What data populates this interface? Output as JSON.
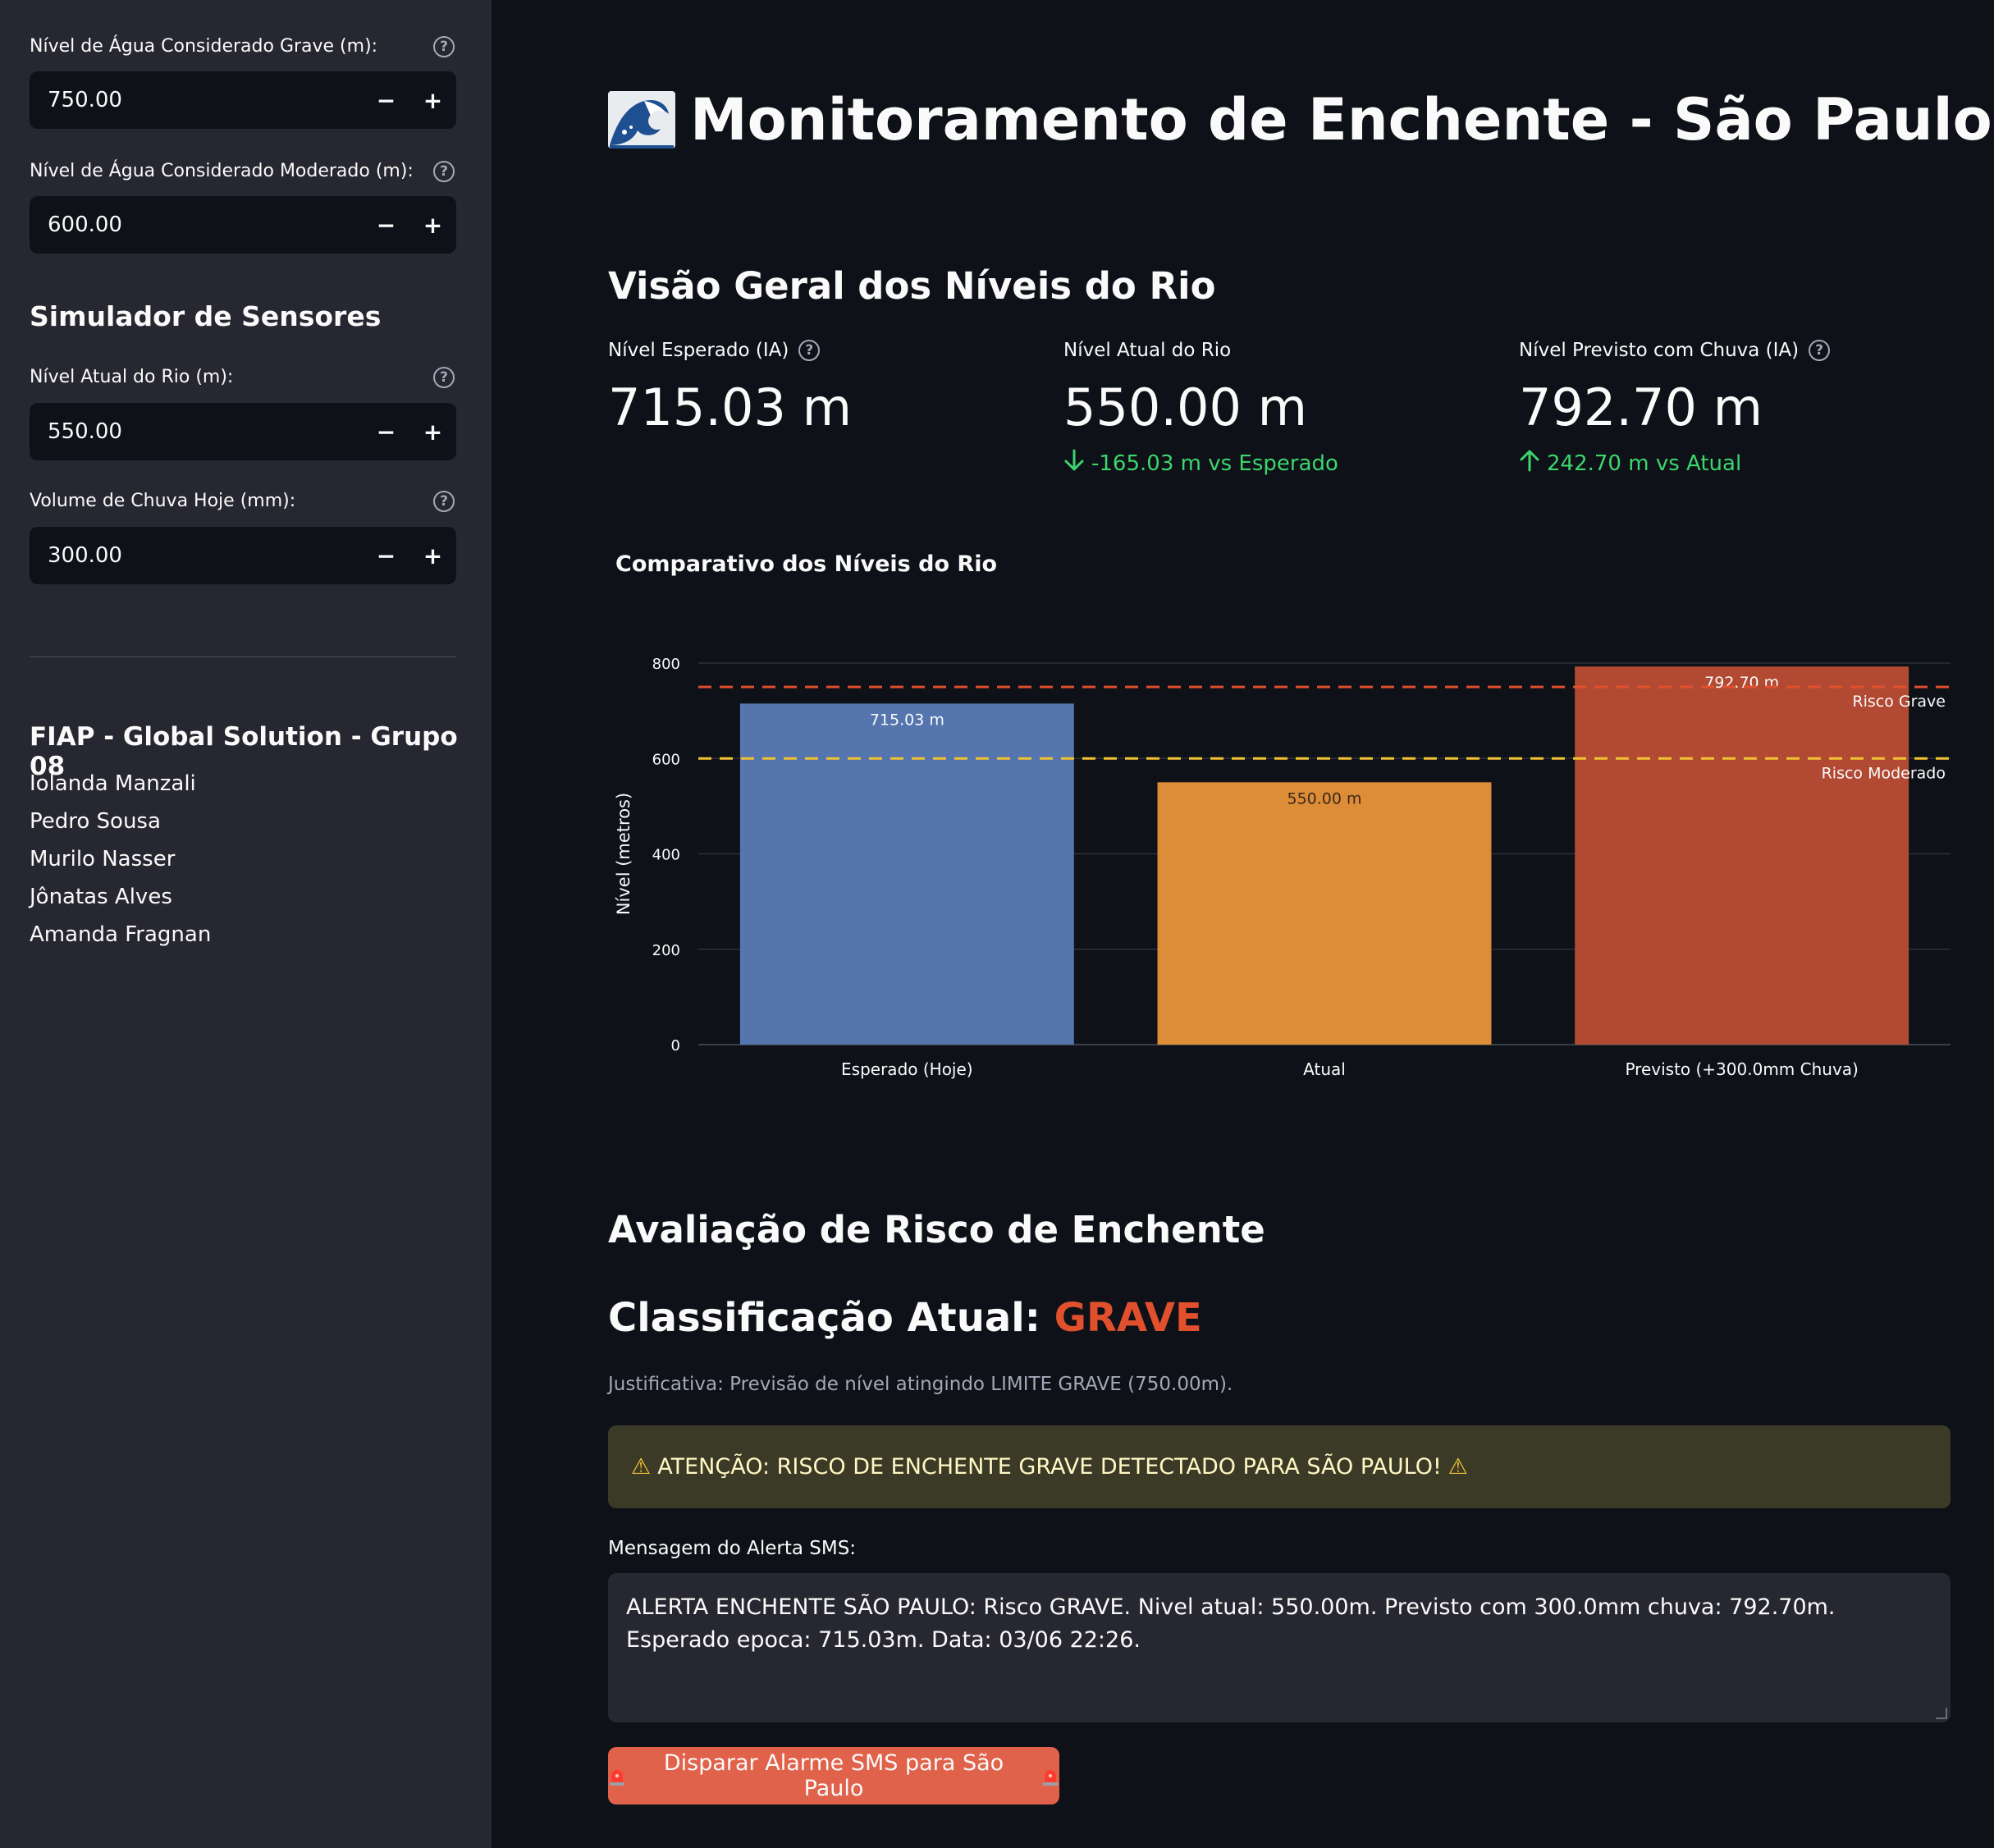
{
  "sidebar": {
    "grave_label": "Nível de Água Considerado Grave (m):",
    "grave_value": "750.00",
    "moderado_label": "Nível de Água Considerado Moderado (m):",
    "moderado_value": "600.00",
    "simulator_heading": "Simulador de Sensores",
    "nivel_atual_label": "Nível Atual do Rio (m):",
    "nivel_atual_value": "550.00",
    "chuva_label": "Volume de Chuva Hoje (mm):",
    "chuva_value": "300.00",
    "minus": "−",
    "plus": "+",
    "help": "?",
    "team_heading": "FIAP - Global Solution - Grupo 08",
    "team": [
      "Iolanda Manzali",
      "Pedro Sousa",
      "Murilo Nasser",
      "Jônatas Alves",
      "Amanda Fragnan"
    ]
  },
  "main": {
    "title": "Monitoramento de Enchente - São Paulo",
    "overview_heading": "Visão Geral dos Níveis do Rio",
    "metrics": [
      {
        "label": "Nível Esperado (IA)",
        "value": "715.03 m",
        "delta": ""
      },
      {
        "label": "Nível Atual do Rio",
        "value": "550.00 m",
        "delta": "-165.03 m vs Esperado",
        "delta_dir": "down"
      },
      {
        "label": "Nível Previsto com Chuva (IA)",
        "value": "792.70 m",
        "delta": "242.70 m vs Atual",
        "delta_dir": "up"
      }
    ],
    "chart_title": "Comparativo dos Níveis do Rio",
    "risk_heading": "Avaliação de Risco de Enchente",
    "classification_prefix": "Classificação Atual: ",
    "classification_value": "GRAVE",
    "justification": "Justificativa: Previsão de nível atingindo LIMITE GRAVE (750.00m).",
    "warning": "ATENÇÃO: RISCO DE ENCHENTE GRAVE DETECTADO PARA SÃO PAULO!",
    "sms_label": "Mensagem do Alerta SMS:",
    "sms_text": "ALERTA ENCHENTE SÃO PAULO: Risco GRAVE. Nivel atual: 550.00m. Previsto com 300.0mm chuva: 792.70m. Esperado epoca: 715.03m. Data: 03/06 22:26.",
    "sms_button": "Disparar Alarme SMS para São Paulo"
  },
  "colors": {
    "grave": "#e0502c",
    "delta": "#3dd56d",
    "button": "#e0624a"
  },
  "chart_data": {
    "type": "bar",
    "title": "Comparativo dos Níveis do Rio",
    "ylabel": "Nível (metros)",
    "xlabel": "",
    "categories": [
      "Esperado (Hoje)",
      "Atual",
      "Previsto (+300.0mm Chuva)"
    ],
    "values": [
      715.03,
      550.0,
      792.7
    ],
    "value_labels": [
      "715.03 m",
      "550.00 m",
      "792.70 m"
    ],
    "colors": [
      "#5575ae",
      "#dd8c37",
      "#b24a33"
    ],
    "ylim": [
      0,
      800
    ],
    "yticks": [
      0,
      200,
      400,
      600,
      800
    ],
    "thresholds": [
      {
        "label": "Risco Grave",
        "value": 750,
        "color": "#e0502c"
      },
      {
        "label": "Risco Moderado",
        "value": 600,
        "color": "#f1c232"
      }
    ],
    "grid": true
  }
}
